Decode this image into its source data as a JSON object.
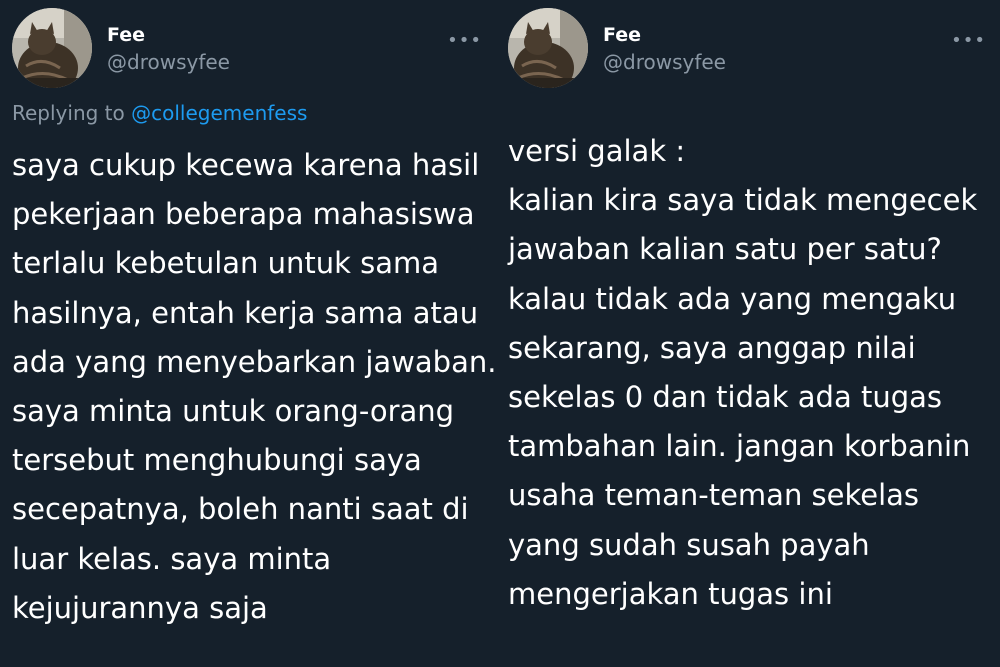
{
  "left_tweet": {
    "display_name": "Fee",
    "handle": "@drowsyfee",
    "more_label": "•••",
    "reply_prefix": "Replying to",
    "reply_mention": "@collegemenfess",
    "lines": [
      "saya cukup kecewa karena hasil",
      "pekerjaan beberapa mahasiswa",
      "terlalu kebetulan untuk sama",
      "hasilnya, entah kerja sama atau",
      "ada yang menyebarkan jawaban.",
      "saya minta untuk orang-orang",
      "tersebut menghubungi saya",
      "secepatnya, boleh nanti saat di",
      "luar kelas. saya minta",
      "kejujurannya saja"
    ]
  },
  "right_tweet": {
    "display_name": "Fee",
    "handle": "@drowsyfee",
    "more_label": "•••",
    "lines": [
      "versi galak :",
      "kalian kira saya tidak mengecek",
      "jawaban kalian satu per satu?",
      "kalau tidak ada yang mengaku",
      "sekarang, saya anggap nilai",
      "sekelas 0 dan tidak ada tugas",
      "tambahan lain. jangan korbanin",
      "usaha teman-teman sekelas",
      "yang sudah susah payah",
      "mengerjakan tugas ini"
    ]
  },
  "colors": {
    "background": "#15202b",
    "text_primary": "#ffffff",
    "text_secondary": "#8b98a5",
    "link": "#1d9bf0"
  },
  "icons": {
    "avatar": "cat-photo-avatar",
    "more": "more-options-icon"
  }
}
